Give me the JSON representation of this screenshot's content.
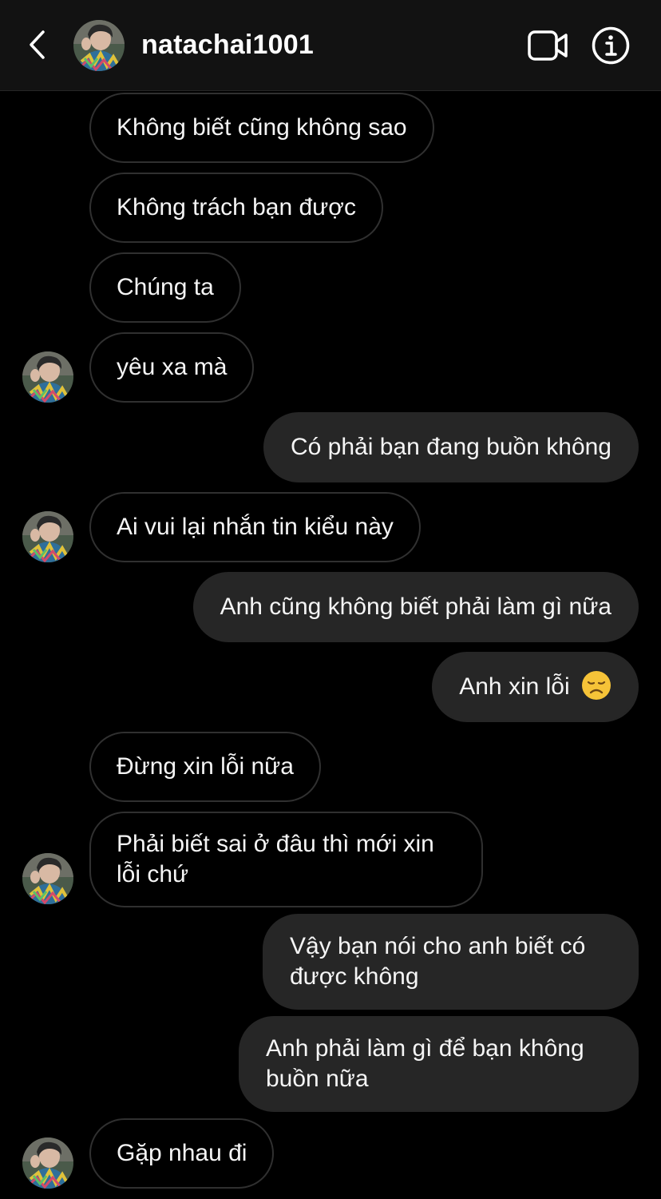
{
  "header": {
    "username": "natachai1001",
    "back_icon": "chevron-left-icon",
    "video_icon": "video-camera-icon",
    "info_icon": "info-icon"
  },
  "colors": {
    "background": "#000000",
    "header_bg": "#121212",
    "incoming_border": "#303030",
    "outgoing_bg": "#262626",
    "text": "#f5f5f5"
  },
  "messages": [
    {
      "side": "in",
      "text": "Không biết cũng không sao"
    },
    {
      "side": "in",
      "text": "Không trách bạn được"
    },
    {
      "side": "in",
      "text": "Chúng ta"
    },
    {
      "side": "in",
      "text": "yêu xa mà"
    },
    {
      "side": "out",
      "text": "Có phải bạn đang buồn không"
    },
    {
      "side": "in",
      "text": "Ai vui lại nhắn tin kiểu này"
    },
    {
      "side": "out",
      "text": "Anh cũng không biết phải làm gì nữa"
    },
    {
      "side": "out",
      "text": "Anh xin lỗi",
      "emoji": "disappointed-face-icon"
    },
    {
      "side": "in",
      "text": "Đừng xin lỗi nữa"
    },
    {
      "side": "in",
      "text": "Phải biết sai ở đâu thì mới xin lỗi chứ"
    },
    {
      "side": "out",
      "text": "Vậy bạn nói cho anh biết có được không"
    },
    {
      "side": "out",
      "text": "Anh phải làm gì để bạn không buồn nữa"
    },
    {
      "side": "in",
      "text": "Gặp nhau đi"
    }
  ]
}
